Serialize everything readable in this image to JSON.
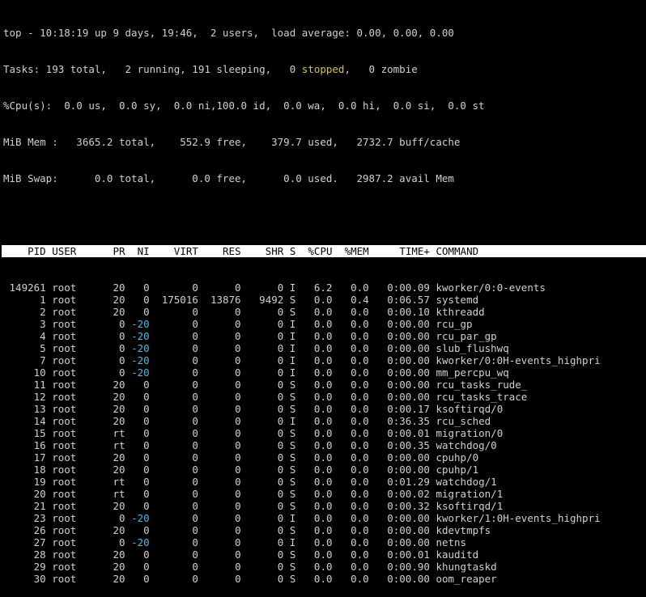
{
  "summary": {
    "line1": "top - 10:18:19 up 9 days, 19:46,  2 users,  load average: 0.00, 0.00, 0.00",
    "tasks_pre": "Tasks: 193 total,   2 running, 191 sleeping,   0 ",
    "tasks_stopped": "stopped",
    "tasks_post": ",   0 zombie",
    "cpu": "%Cpu(s):  0.0 us,  0.0 sy,  0.0 ni,100.0 id,  0.0 wa,  0.0 hi,  0.0 si,  0.0 st",
    "mem": "MiB Mem :   3665.2 total,    552.9 free,    379.7 used,   2732.7 buff/cache",
    "swap": "MiB Swap:      0.0 total,      0.0 free,      0.0 used.   2987.2 avail Mem"
  },
  "colors": {
    "background": "#000000",
    "text": "#d0d0d0",
    "header_bg": "#ffffff",
    "negative_nice": "#4fb7e3",
    "stopped": "#d6c43c"
  },
  "columns": [
    "PID",
    "USER",
    "PR",
    "NI",
    "VIRT",
    "RES",
    "SHR",
    "S",
    "%CPU",
    "%MEM",
    "TIME+",
    "COMMAND"
  ],
  "processes": [
    {
      "pid": "149261",
      "user": "root",
      "pr": "20",
      "ni": "0",
      "virt": "0",
      "res": "0",
      "shr": "0",
      "s": "I",
      "cpu": "6.2",
      "mem": "0.0",
      "time": "0:00.09",
      "command": "kworker/0:0-events"
    },
    {
      "pid": "1",
      "user": "root",
      "pr": "20",
      "ni": "0",
      "virt": "175016",
      "res": "13876",
      "shr": "9492",
      "s": "S",
      "cpu": "0.0",
      "mem": "0.4",
      "time": "0:06.57",
      "command": "systemd"
    },
    {
      "pid": "2",
      "user": "root",
      "pr": "20",
      "ni": "0",
      "virt": "0",
      "res": "0",
      "shr": "0",
      "s": "S",
      "cpu": "0.0",
      "mem": "0.0",
      "time": "0:00.10",
      "command": "kthreadd"
    },
    {
      "pid": "3",
      "user": "root",
      "pr": "0",
      "ni": "-20",
      "virt": "0",
      "res": "0",
      "shr": "0",
      "s": "I",
      "cpu": "0.0",
      "mem": "0.0",
      "time": "0:00.00",
      "command": "rcu_gp"
    },
    {
      "pid": "4",
      "user": "root",
      "pr": "0",
      "ni": "-20",
      "virt": "0",
      "res": "0",
      "shr": "0",
      "s": "I",
      "cpu": "0.0",
      "mem": "0.0",
      "time": "0:00.00",
      "command": "rcu_par_gp"
    },
    {
      "pid": "5",
      "user": "root",
      "pr": "0",
      "ni": "-20",
      "virt": "0",
      "res": "0",
      "shr": "0",
      "s": "I",
      "cpu": "0.0",
      "mem": "0.0",
      "time": "0:00.00",
      "command": "slub_flushwq"
    },
    {
      "pid": "7",
      "user": "root",
      "pr": "0",
      "ni": "-20",
      "virt": "0",
      "res": "0",
      "shr": "0",
      "s": "I",
      "cpu": "0.0",
      "mem": "0.0",
      "time": "0:00.00",
      "command": "kworker/0:0H-events_highpri"
    },
    {
      "pid": "10",
      "user": "root",
      "pr": "0",
      "ni": "-20",
      "virt": "0",
      "res": "0",
      "shr": "0",
      "s": "I",
      "cpu": "0.0",
      "mem": "0.0",
      "time": "0:00.00",
      "command": "mm_percpu_wq"
    },
    {
      "pid": "11",
      "user": "root",
      "pr": "20",
      "ni": "0",
      "virt": "0",
      "res": "0",
      "shr": "0",
      "s": "S",
      "cpu": "0.0",
      "mem": "0.0",
      "time": "0:00.00",
      "command": "rcu_tasks_rude_"
    },
    {
      "pid": "12",
      "user": "root",
      "pr": "20",
      "ni": "0",
      "virt": "0",
      "res": "0",
      "shr": "0",
      "s": "S",
      "cpu": "0.0",
      "mem": "0.0",
      "time": "0:00.00",
      "command": "rcu_tasks_trace"
    },
    {
      "pid": "13",
      "user": "root",
      "pr": "20",
      "ni": "0",
      "virt": "0",
      "res": "0",
      "shr": "0",
      "s": "S",
      "cpu": "0.0",
      "mem": "0.0",
      "time": "0:00.17",
      "command": "ksoftirqd/0"
    },
    {
      "pid": "14",
      "user": "root",
      "pr": "20",
      "ni": "0",
      "virt": "0",
      "res": "0",
      "shr": "0",
      "s": "I",
      "cpu": "0.0",
      "mem": "0.0",
      "time": "0:36.35",
      "command": "rcu_sched"
    },
    {
      "pid": "15",
      "user": "root",
      "pr": "rt",
      "ni": "0",
      "virt": "0",
      "res": "0",
      "shr": "0",
      "s": "S",
      "cpu": "0.0",
      "mem": "0.0",
      "time": "0:00.01",
      "command": "migration/0"
    },
    {
      "pid": "16",
      "user": "root",
      "pr": "rt",
      "ni": "0",
      "virt": "0",
      "res": "0",
      "shr": "0",
      "s": "S",
      "cpu": "0.0",
      "mem": "0.0",
      "time": "0:00.35",
      "command": "watchdog/0"
    },
    {
      "pid": "17",
      "user": "root",
      "pr": "20",
      "ni": "0",
      "virt": "0",
      "res": "0",
      "shr": "0",
      "s": "S",
      "cpu": "0.0",
      "mem": "0.0",
      "time": "0:00.00",
      "command": "cpuhp/0"
    },
    {
      "pid": "18",
      "user": "root",
      "pr": "20",
      "ni": "0",
      "virt": "0",
      "res": "0",
      "shr": "0",
      "s": "S",
      "cpu": "0.0",
      "mem": "0.0",
      "time": "0:00.00",
      "command": "cpuhp/1"
    },
    {
      "pid": "19",
      "user": "root",
      "pr": "rt",
      "ni": "0",
      "virt": "0",
      "res": "0",
      "shr": "0",
      "s": "S",
      "cpu": "0.0",
      "mem": "0.0",
      "time": "0:01.29",
      "command": "watchdog/1"
    },
    {
      "pid": "20",
      "user": "root",
      "pr": "rt",
      "ni": "0",
      "virt": "0",
      "res": "0",
      "shr": "0",
      "s": "S",
      "cpu": "0.0",
      "mem": "0.0",
      "time": "0:00.02",
      "command": "migration/1"
    },
    {
      "pid": "21",
      "user": "root",
      "pr": "20",
      "ni": "0",
      "virt": "0",
      "res": "0",
      "shr": "0",
      "s": "S",
      "cpu": "0.0",
      "mem": "0.0",
      "time": "0:00.32",
      "command": "ksoftirqd/1"
    },
    {
      "pid": "23",
      "user": "root",
      "pr": "0",
      "ni": "-20",
      "virt": "0",
      "res": "0",
      "shr": "0",
      "s": "I",
      "cpu": "0.0",
      "mem": "0.0",
      "time": "0:00.00",
      "command": "kworker/1:0H-events_highpri"
    },
    {
      "pid": "26",
      "user": "root",
      "pr": "20",
      "ni": "0",
      "virt": "0",
      "res": "0",
      "shr": "0",
      "s": "S",
      "cpu": "0.0",
      "mem": "0.0",
      "time": "0:00.00",
      "command": "kdevtmpfs"
    },
    {
      "pid": "27",
      "user": "root",
      "pr": "0",
      "ni": "-20",
      "virt": "0",
      "res": "0",
      "shr": "0",
      "s": "I",
      "cpu": "0.0",
      "mem": "0.0",
      "time": "0:00.00",
      "command": "netns"
    },
    {
      "pid": "28",
      "user": "root",
      "pr": "20",
      "ni": "0",
      "virt": "0",
      "res": "0",
      "shr": "0",
      "s": "S",
      "cpu": "0.0",
      "mem": "0.0",
      "time": "0:00.01",
      "command": "kauditd"
    },
    {
      "pid": "29",
      "user": "root",
      "pr": "20",
      "ni": "0",
      "virt": "0",
      "res": "0",
      "shr": "0",
      "s": "S",
      "cpu": "0.0",
      "mem": "0.0",
      "time": "0:00.90",
      "command": "khungtaskd"
    },
    {
      "pid": "30",
      "user": "root",
      "pr": "20",
      "ni": "0",
      "virt": "0",
      "res": "0",
      "shr": "0",
      "s": "S",
      "cpu": "0.0",
      "mem": "0.0",
      "time": "0:00.00",
      "command": "oom_reaper"
    }
  ]
}
